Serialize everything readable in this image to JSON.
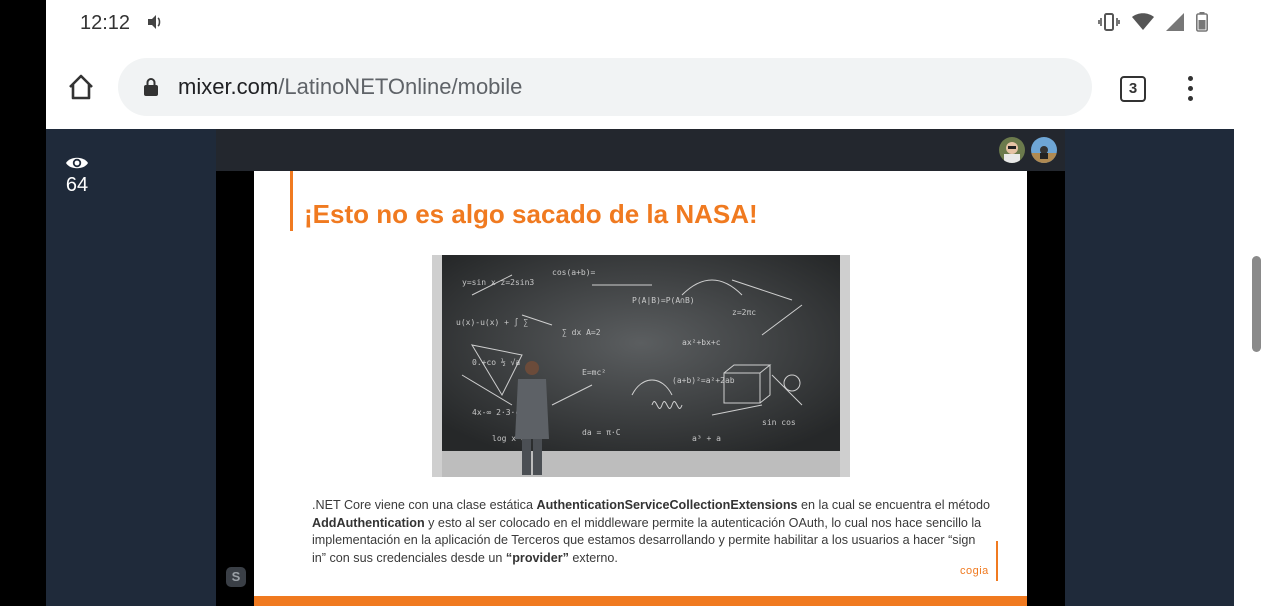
{
  "status": {
    "time": "12:12"
  },
  "browser": {
    "url_host": "mixer.com",
    "url_path": "/LatinoNETOnline/mobile",
    "tab_count": "3"
  },
  "stream": {
    "viewer_count": "64",
    "badge": "S"
  },
  "slide": {
    "title": "¡Esto no es algo sacado de la NASA!",
    "p1": ".NET Core viene con una clase estática ",
    "b1": "AuthenticationServiceCollectionExtensions",
    "p2": " en la cual se encuentra el método ",
    "b2": "AddAuthentication",
    "p3": " y esto al ser colocado en el middleware permite la autenticación OAuth, lo cual nos hace sencillo la implementación en la aplicación de Terceros que estamos desarrollando y permite habilitar a los usuarios a hacer “sign in” con sus credenciales desde un ",
    "b3": "“provider”",
    "p4": " externo.",
    "logo": "cogia"
  },
  "colors": {
    "accent": "#f07a20",
    "panel": "#1f2a3a"
  }
}
